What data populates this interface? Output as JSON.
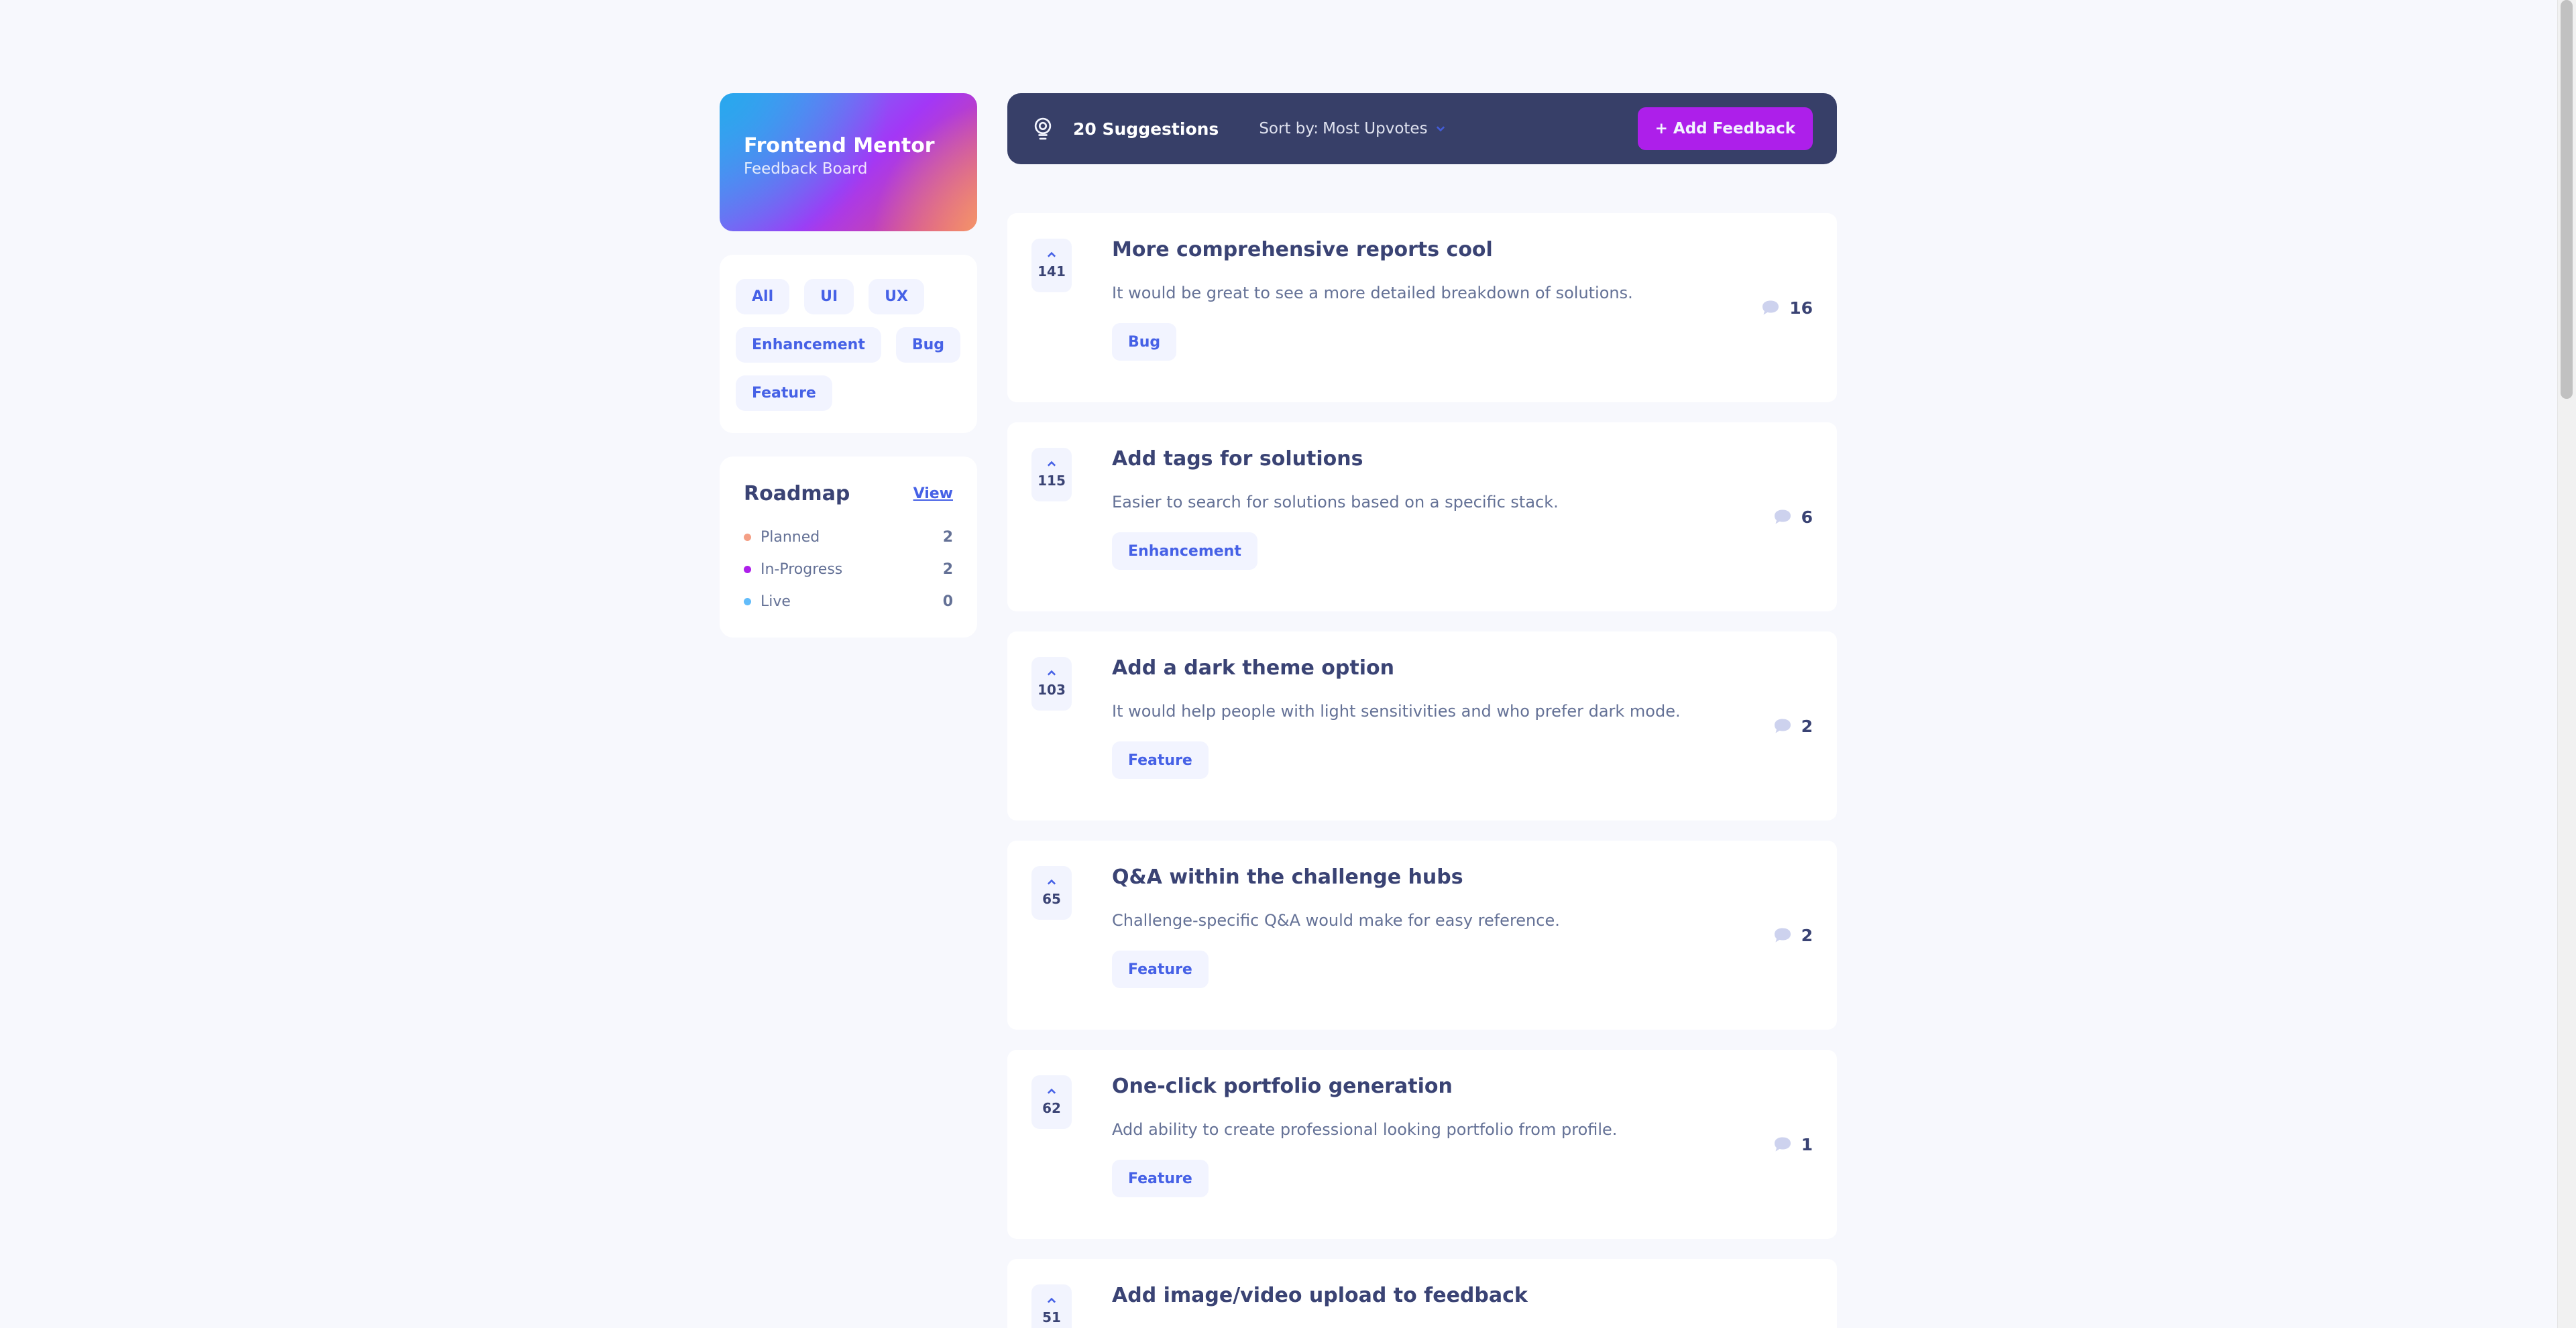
{
  "brand": {
    "title": "Frontend Mentor",
    "subtitle": "Feedback Board"
  },
  "filters": [
    "All",
    "UI",
    "UX",
    "Enhancement",
    "Bug",
    "Feature"
  ],
  "roadmap": {
    "title": "Roadmap",
    "view_label": "View",
    "items": [
      {
        "label": "Planned",
        "count": "2",
        "color": "#f49f85"
      },
      {
        "label": "In-Progress",
        "count": "2",
        "color": "#ad1fea"
      },
      {
        "label": "Live",
        "count": "0",
        "color": "#62bcfa"
      }
    ]
  },
  "topbar": {
    "count_label": "20 Suggestions",
    "sort_label": "Sort by:",
    "sort_value": "Most Upvotes",
    "add_label": "+ Add Feedback",
    "icons": {
      "bulb": "lightbulb-icon",
      "chevron": "chevron-down-icon"
    }
  },
  "feedback": [
    {
      "votes": "141",
      "title": "More comprehensive reports cool",
      "description": "It would be great to see a more detailed breakdown of solutions.",
      "tag": "Bug",
      "comments": "16"
    },
    {
      "votes": "115",
      "title": "Add tags for solutions",
      "description": "Easier to search for solutions based on a specific stack.",
      "tag": "Enhancement",
      "comments": "6"
    },
    {
      "votes": "103",
      "title": "Add a dark theme option",
      "description": "It would help people with light sensitivities and who prefer dark mode.",
      "tag": "Feature",
      "comments": "2"
    },
    {
      "votes": "65",
      "title": "Q&A within the challenge hubs",
      "description": "Challenge-specific Q&A would make for easy reference.",
      "tag": "Feature",
      "comments": "2"
    },
    {
      "votes": "62",
      "title": "One-click portfolio generation",
      "description": "Add ability to create professional looking portfolio from profile.",
      "tag": "Feature",
      "comments": "1"
    },
    {
      "votes": "51",
      "title": "Add image/video upload to feedback",
      "description": "",
      "tag": "",
      "comments": ""
    }
  ],
  "colors": {
    "accent": "#ad1fea",
    "primary": "#4661e6",
    "dark": "#373f68",
    "text": "#3a4374",
    "muted": "#647196"
  }
}
